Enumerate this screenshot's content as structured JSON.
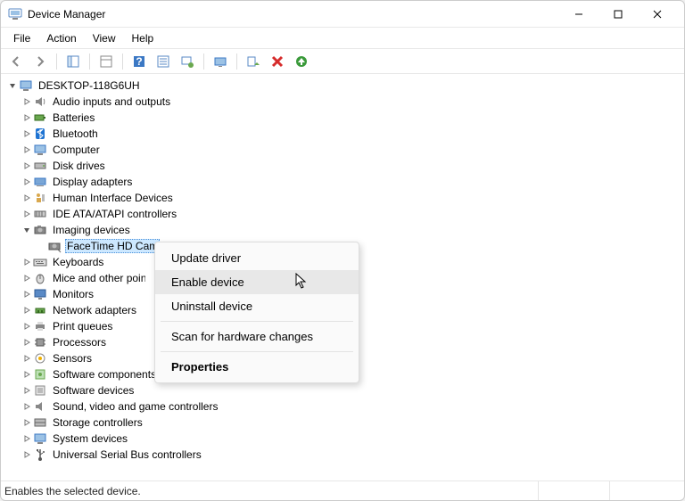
{
  "title": "Device Manager",
  "menu": {
    "file": "File",
    "action": "Action",
    "view": "View",
    "help": "Help"
  },
  "status": "Enables the selected device.",
  "tree": {
    "root": "DESKTOP-118G6UH",
    "c0": "Audio inputs and outputs",
    "c1": "Batteries",
    "c2": "Bluetooth",
    "c3": "Computer",
    "c4": "Disk drives",
    "c5": "Display adapters",
    "c6": "Human Interface Devices",
    "c7": "IDE ATA/ATAPI controllers",
    "c8": "Imaging devices",
    "c8_child": "FaceTime HD Camera",
    "c9": "Keyboards",
    "c10": "Mice and other pointing devices",
    "c11": "Monitors",
    "c12": "Network adapters",
    "c13": "Print queues",
    "c14": "Processors",
    "c15": "Sensors",
    "c16": "Software components",
    "c17": "Software devices",
    "c18": "Sound, video and game controllers",
    "c19": "Storage controllers",
    "c20": "System devices",
    "c21": "Universal Serial Bus controllers"
  },
  "ctx": {
    "update": "Update driver",
    "enable": "Enable device",
    "uninstall": "Uninstall device",
    "scan": "Scan for hardware changes",
    "properties": "Properties"
  }
}
